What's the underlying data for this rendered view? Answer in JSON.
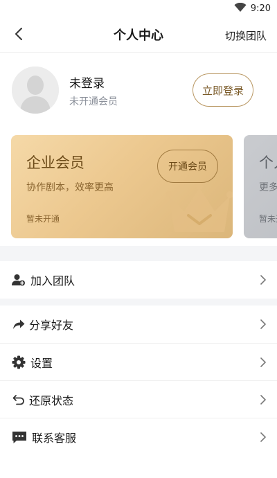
{
  "status_bar": {
    "time": "9:20",
    "icons": [
      "wifi-icon",
      "battery-icon"
    ]
  },
  "nav": {
    "title": "个人中心",
    "action": "切换团队",
    "back_icon": "chevron-left-icon"
  },
  "profile": {
    "name": "未登录",
    "membership": "未开通会员",
    "login_label": "立即登录",
    "avatar_icon": "default-avatar-icon"
  },
  "cards": [
    {
      "title": "企业会员",
      "desc": "协作剧本，效率更高",
      "status": "暂未开通",
      "button": "开通会员",
      "icon": "crown-icon"
    },
    {
      "title": "个人会员",
      "desc": "更多特权",
      "status": "暂未开通"
    }
  ],
  "menu": [
    {
      "label": "加入团队",
      "icon": "add-user-icon"
    },
    {
      "label": "分享好友",
      "icon": "share-icon"
    },
    {
      "label": "设置",
      "icon": "gear-icon"
    },
    {
      "label": "还原状态",
      "icon": "undo-icon"
    },
    {
      "label": "联系客服",
      "icon": "chat-icon"
    }
  ],
  "colors": {
    "accent_gold": "#b89660",
    "card_gold": "#ecc88f",
    "card_gray": "#b4b7bc",
    "band_gray": "#f4f5f7"
  }
}
